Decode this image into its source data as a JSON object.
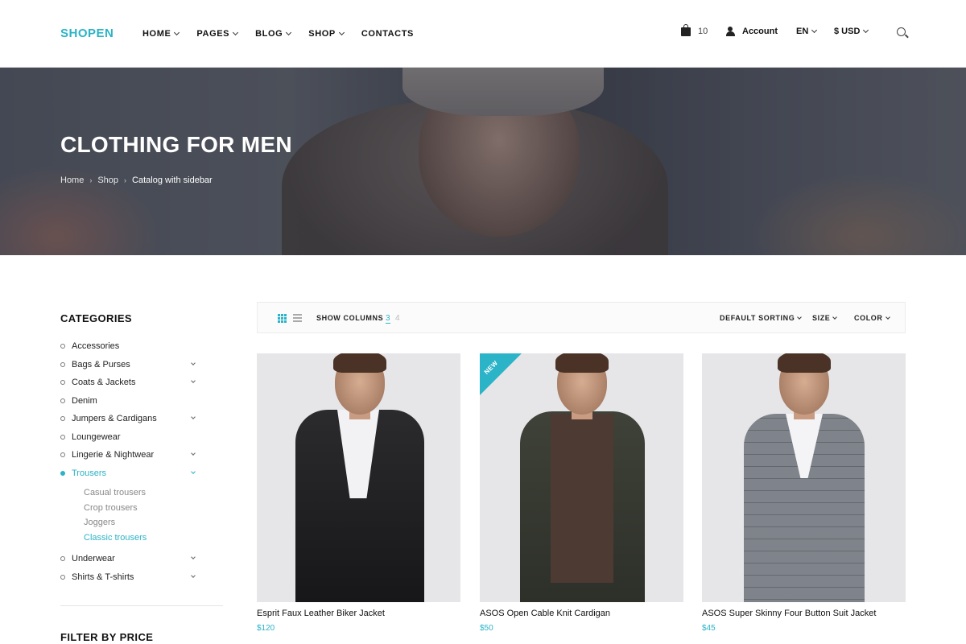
{
  "header": {
    "logo": "SHOPEN",
    "nav": [
      "HOME",
      "PAGES",
      "BLOG",
      "SHOP",
      "CONTACTS"
    ],
    "cart_count": "10",
    "account_label": "Account",
    "language": "EN",
    "currency": "$ USD"
  },
  "hero": {
    "title": "CLOTHING FOR MEN",
    "breadcrumb": [
      "Home",
      "Shop",
      "Catalog with sidebar"
    ]
  },
  "sidebar": {
    "categories_title": "CATEGORIES",
    "categories": [
      {
        "label": "Accessories",
        "has_children": false
      },
      {
        "label": "Bags & Purses",
        "has_children": true
      },
      {
        "label": "Coats & Jackets",
        "has_children": true
      },
      {
        "label": "Denim",
        "has_children": false
      },
      {
        "label": "Jumpers & Cardigans",
        "has_children": true
      },
      {
        "label": "Loungewear",
        "has_children": false
      },
      {
        "label": "Lingerie & Nightwear",
        "has_children": true
      },
      {
        "label": "Trousers",
        "has_children": true,
        "active": true
      },
      {
        "label": "Underwear",
        "has_children": true
      },
      {
        "label": "Shirts & T-shirts",
        "has_children": true
      }
    ],
    "trousers_sub": [
      "Casual trousers",
      "Crop trousers",
      "Joggers",
      "Classic trousers"
    ],
    "trousers_sub_active": "Classic trousers",
    "filter_title": "FILTER BY PRICE"
  },
  "toolbar": {
    "show_columns_label": "SHOW COLUMNS",
    "column_options": [
      "3",
      "4"
    ],
    "active_columns": "3",
    "sorting_label": "DEFAULT SORTING",
    "size_label": "SIZE",
    "color_label": "COLOR"
  },
  "products": [
    {
      "name": "Esprit Faux Leather Biker Jacket",
      "price": "$120",
      "badge": ""
    },
    {
      "name": "ASOS Open Cable Knit Cardigan",
      "price": "$50",
      "badge": "NEW"
    },
    {
      "name": "ASOS Super Skinny Four Button Suit Jacket",
      "price": "$45",
      "badge": ""
    }
  ],
  "colors": {
    "accent": "#2bb3c7",
    "text": "#222222"
  }
}
